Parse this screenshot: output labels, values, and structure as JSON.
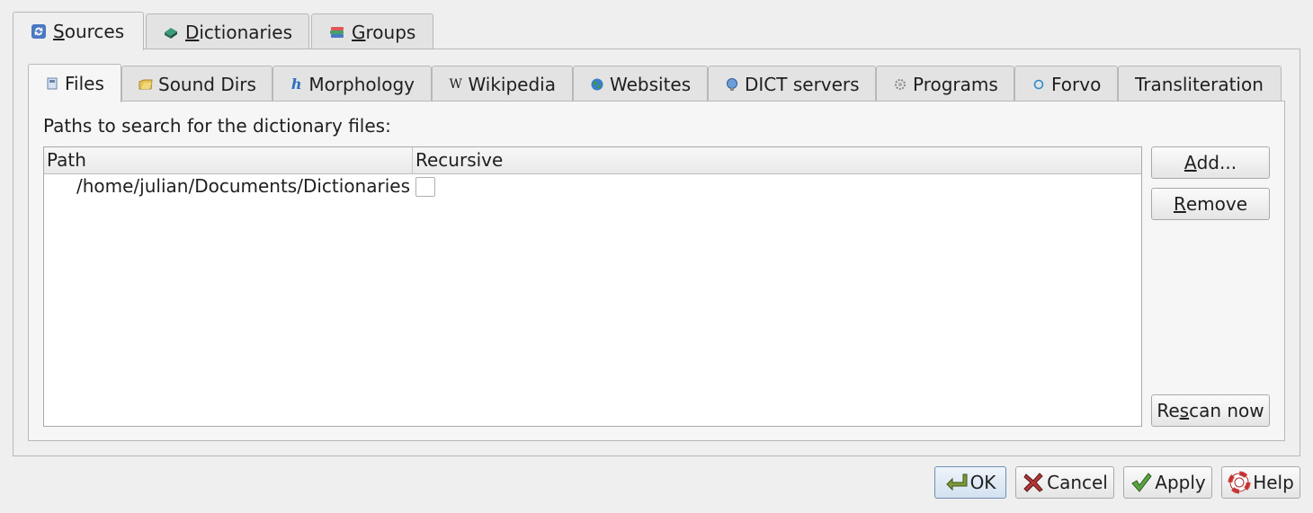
{
  "top_tabs": [
    {
      "label": "Sources",
      "mnemonic_index": 0,
      "icon": "sources-icon",
      "active": true
    },
    {
      "label": "Dictionaries",
      "mnemonic_index": 0,
      "icon": "dictionaries-icon",
      "active": false
    },
    {
      "label": "Groups",
      "mnemonic_index": 0,
      "icon": "groups-icon",
      "active": false
    }
  ],
  "inner_tabs": [
    {
      "label": "Files",
      "icon": "files-icon",
      "active": true
    },
    {
      "label": "Sound Dirs",
      "icon": "sound-dirs-icon",
      "active": false
    },
    {
      "label": "Morphology",
      "icon": "morphology-icon",
      "active": false
    },
    {
      "label": "Wikipedia",
      "icon": "wikipedia-icon",
      "active": false
    },
    {
      "label": "Websites",
      "icon": "websites-icon",
      "active": false
    },
    {
      "label": "DICT servers",
      "icon": "dict-servers-icon",
      "active": false
    },
    {
      "label": "Programs",
      "icon": "programs-icon",
      "active": false
    },
    {
      "label": "Forvo",
      "icon": "forvo-icon",
      "active": false
    },
    {
      "label": "Transliteration",
      "icon": "",
      "active": false
    }
  ],
  "files": {
    "paths_label": "Paths to search for the dictionary files:",
    "columns": [
      "Path",
      "Recursive"
    ],
    "rows": [
      {
        "path": "/home/julian/Documents/Dictionaries",
        "recursive": false
      }
    ],
    "buttons": {
      "add": {
        "label": "Add...",
        "mnemonic": "A",
        "rest": "dd..."
      },
      "remove": {
        "label": "Remove",
        "mnemonic": "R",
        "rest": "emove"
      },
      "rescan": {
        "label": "Rescan now",
        "pre": "Re",
        "mnemonic": "s",
        "rest": "can now"
      }
    }
  },
  "dialog_buttons": {
    "ok": {
      "label": "OK",
      "icon": "ok-icon"
    },
    "cancel": {
      "label": "Cancel",
      "icon": "cancel-icon"
    },
    "apply": {
      "label": "Apply",
      "icon": "apply-icon"
    },
    "help": {
      "label": "Help",
      "icon": "help-icon"
    }
  }
}
